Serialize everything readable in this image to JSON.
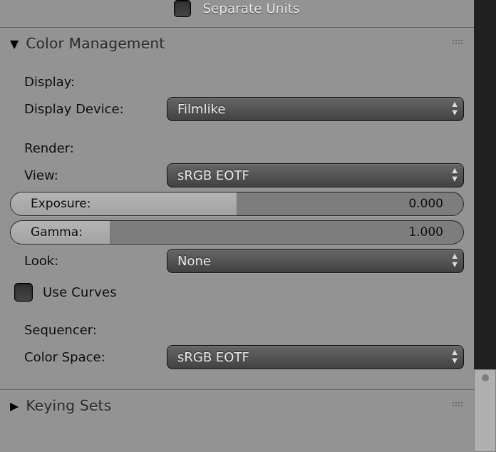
{
  "top": {
    "separate_units": "Separate Units"
  },
  "section": {
    "title": "Color Management",
    "display_header": "Display:",
    "display_device_label": "Display Device:",
    "display_device_value": "Filmlike",
    "render_header": "Render:",
    "view_label": "View:",
    "view_value": "sRGB EOTF",
    "exposure_label": "Exposure:",
    "exposure_value": "0.000",
    "gamma_label": "Gamma:",
    "gamma_value": "1.000",
    "look_label": "Look:",
    "look_value": "None",
    "use_curves_label": "Use Curves",
    "sequencer_header": "Sequencer:",
    "color_space_label": "Color Space:",
    "color_space_value": "sRGB EOTF"
  },
  "section2": {
    "title": "Keying Sets"
  }
}
